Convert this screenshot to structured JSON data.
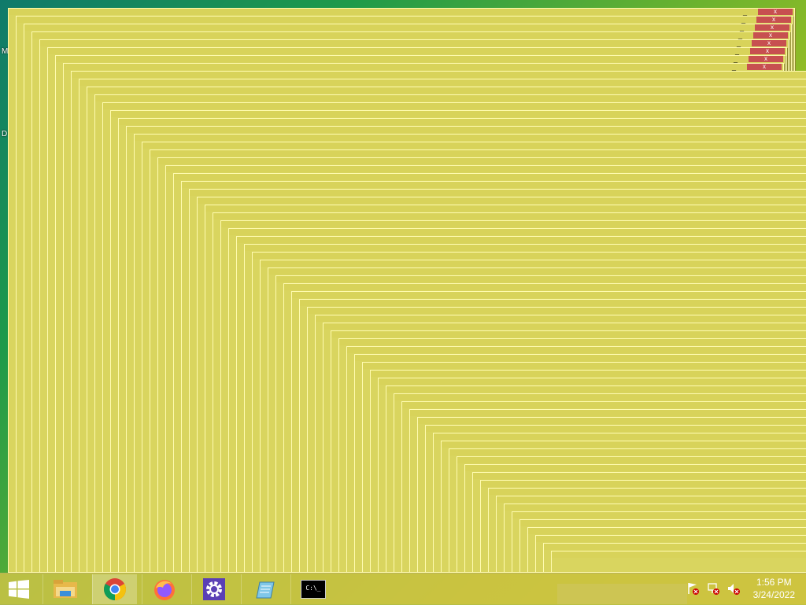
{
  "desktop": {
    "icon_letters": [
      "M",
      "D"
    ],
    "window_color": "#d9d55f",
    "close_label": "x",
    "minimize_label": "_"
  },
  "taskbar": {
    "apps": [
      {
        "name": "file-explorer-icon"
      },
      {
        "name": "chrome-icon"
      },
      {
        "name": "firefox-icon"
      },
      {
        "name": "settings-icon"
      },
      {
        "name": "notepad-icon"
      },
      {
        "name": "terminal-icon",
        "label": "C:\\_"
      }
    ]
  },
  "tray": {
    "time": "1:56 PM",
    "date": "3/24/2022"
  }
}
